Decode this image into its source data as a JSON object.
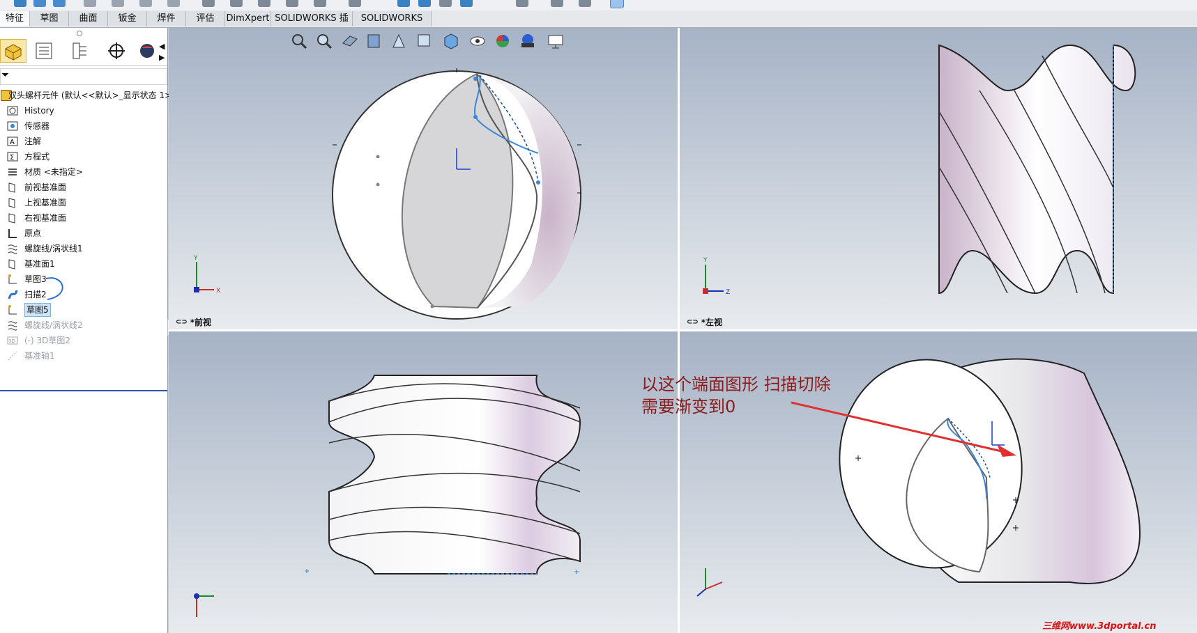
{
  "tabs": [
    "特征",
    "草图",
    "曲面",
    "钣金",
    "焊件",
    "评估",
    "DimXpert",
    "SOLIDWORKS 插件",
    "SOLIDWORKS MBD"
  ],
  "active_tab": "特征",
  "panel": {
    "tools": [
      "feature-manager-icon",
      "property-manager-icon",
      "configuration-manager-icon",
      "dimxpert-icon",
      "display-manager-icon"
    ],
    "tree_root": "双头螺杆元件 (默认<<默认>_显示状态 1>",
    "tree": [
      {
        "label": "History",
        "icon": "history-icon"
      },
      {
        "label": "传感器",
        "icon": "sensor-icon"
      },
      {
        "label": "注解",
        "icon": "annotation-icon"
      },
      {
        "label": "方程式",
        "icon": "equation-icon"
      },
      {
        "label": "材质 <未指定>",
        "icon": "material-icon"
      },
      {
        "label": "前视基准面",
        "icon": "plane-icon"
      },
      {
        "label": "上视基准面",
        "icon": "plane-icon"
      },
      {
        "label": "右视基准面",
        "icon": "plane-icon"
      },
      {
        "label": "原点",
        "icon": "origin-icon"
      },
      {
        "label": "螺旋线/涡状线1",
        "icon": "helix-icon"
      },
      {
        "label": "基准面1",
        "icon": "plane-icon"
      },
      {
        "label": "草图3",
        "icon": "sketch-icon"
      },
      {
        "label": "扫描2",
        "icon": "sweep-icon"
      },
      {
        "label": "草图5",
        "icon": "sketch-icon",
        "selected": true
      },
      {
        "label": "螺旋线/涡状线2",
        "icon": "helix-icon",
        "dim": true
      },
      {
        "label": "(-) 3D草图2",
        "icon": "3dsketch-icon",
        "dim": true
      },
      {
        "label": "基准轴1",
        "icon": "axis-icon",
        "dim": true
      }
    ]
  },
  "viewports": {
    "front": {
      "label": "*前视"
    },
    "left": {
      "label": "*左视"
    }
  },
  "triad": {
    "x": "X",
    "y": "Y",
    "z": "Z"
  },
  "annotation": {
    "line1": "以这个端面图形 扫描切除",
    "line2": "需要渐变到0"
  },
  "watermark": "三维网www.3dportal.cn",
  "colors": {
    "accent_blue": "#2a6fd6",
    "annotation_red": "#8b1b1b",
    "arrow_red": "#e03030"
  }
}
